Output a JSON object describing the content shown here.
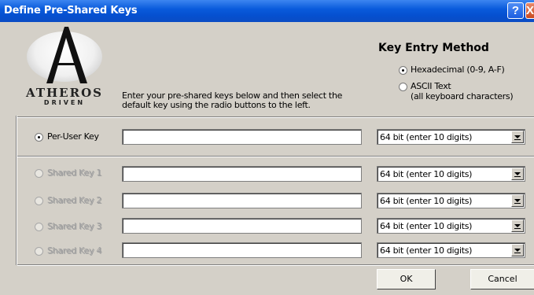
{
  "window": {
    "title": "Define Pre-Shared Keys",
    "help_label": "?",
    "close_label": "X"
  },
  "logo": {
    "brand": "ATHEROS",
    "tagline": "DRIVEN"
  },
  "instructions": "Enter your pre-shared keys below and then select the default key using the radio buttons to the left.",
  "key_entry": {
    "title": "Key Entry Method",
    "options": [
      {
        "label": "Hexadecimal (0-9, A-F)",
        "selected": true
      },
      {
        "label": "ASCII Text\n(all keyboard characters)",
        "line1": "ASCII Text",
        "line2": "(all keyboard characters)",
        "selected": false
      }
    ]
  },
  "per_user": {
    "label": "Per-User Key",
    "value": "",
    "length": "64 bit (enter 10 digits)",
    "selected": true
  },
  "shared_keys": [
    {
      "label": "Shared Key 1",
      "value": "",
      "length": "64 bit (enter 10 digits)"
    },
    {
      "label": "Shared Key 2",
      "value": "",
      "length": "64 bit (enter 10 digits)"
    },
    {
      "label": "Shared Key 3",
      "value": "",
      "length": "64 bit (enter 10 digits)"
    },
    {
      "label": "Shared Key 4",
      "value": "",
      "length": "64 bit (enter 10 digits)"
    }
  ],
  "buttons": {
    "ok": "OK",
    "cancel": "Cancel"
  }
}
